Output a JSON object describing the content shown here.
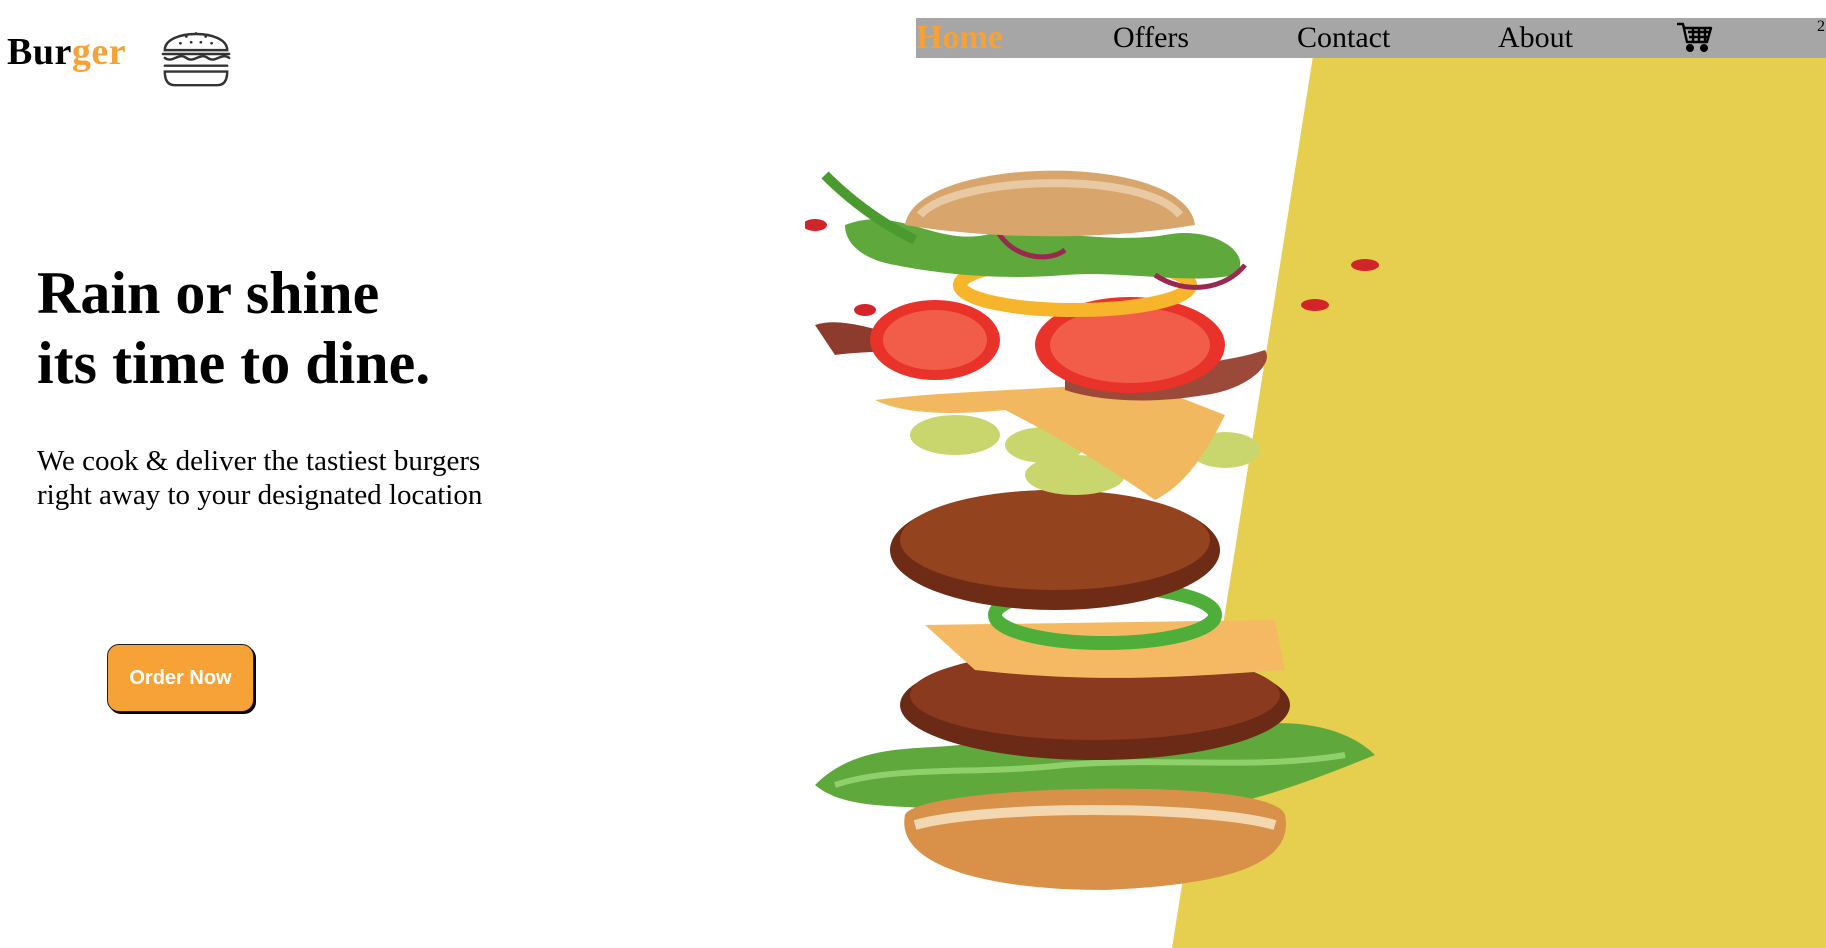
{
  "colors": {
    "accent": "#f7a236",
    "yellow_panel": "#e6ce4f",
    "nav_bg": "#a6a6a6"
  },
  "logo": {
    "text_dark": "Bur",
    "text_accent": "ger",
    "icon": "burger-icon"
  },
  "nav": {
    "items": [
      {
        "label": "Home",
        "active": true
      },
      {
        "label": "Offers",
        "active": false
      },
      {
        "label": "Contact",
        "active": false
      },
      {
        "label": "About",
        "active": false
      }
    ],
    "cart_icon": "cart-icon",
    "cart_count": "2"
  },
  "hero": {
    "title_line1": "Rain or shine",
    "title_line2": "its time to dine.",
    "subtitle_line1": "We cook & deliver the tastiest burgers",
    "subtitle_line2": "right away to your designated location",
    "cta": "Order Now"
  }
}
